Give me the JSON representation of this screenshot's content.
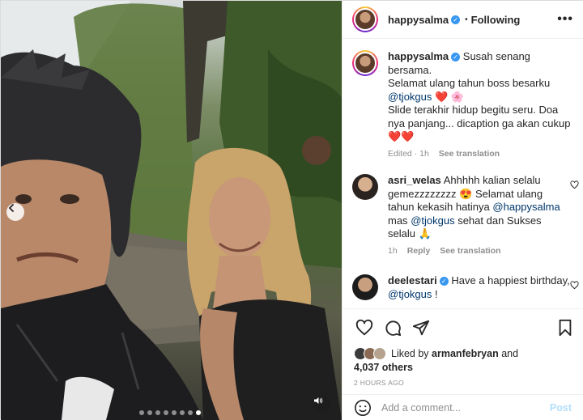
{
  "post": {
    "author": "happysalma",
    "follow_label": "Following",
    "more_label": "•••",
    "dot_separator": "•",
    "caption": {
      "username": "happysalma",
      "text_line1": "Susah senang bersama.",
      "text_line2": "Selamat ulang tahun boss besarku",
      "mention": "@tjokgus",
      "emoji_after_mention": "❤️ 🌸",
      "text_line3": "Slide terakhir hidup begitu seru. Doa nya panjang... dicaption ga akan cukup",
      "emoji_end": "❤️❤️",
      "edited": "Edited · 1h",
      "see_translation": "See translation"
    },
    "comments": [
      {
        "username": "asri_welas",
        "text_a": "Ahhhhh kalian selalu gemezzzzzzzz",
        "emoji_a": "😍",
        "text_b": "Selamat ulang tahun kekasih hatinya",
        "mention_a": "@happysalma",
        "text_c": "mas",
        "mention_b": "@tjokgus",
        "text_d": "sehat dan Sukses selalu",
        "emoji_d": "🙏",
        "time": "1h",
        "reply": "Reply",
        "see_translation": "See translation"
      },
      {
        "username": "deelestari",
        "text_a": "Have a happiest birthday,",
        "mention_a": "@tjokgus",
        "text_b": " !"
      }
    ],
    "liked_by_prefix": "Liked by",
    "liked_by_user": "arman febryan",
    "liked_by_user_display": "armanfebryan",
    "liked_and": "and",
    "likes_count": "4,037 others",
    "time_ago": "2 HOURS AGO",
    "comment_placeholder": "Add a comment...",
    "post_button": "Post"
  },
  "carousel": {
    "slide_count": 8,
    "active_index": 7
  },
  "icons": {
    "prev": "chevron-left-icon",
    "mute": "speaker-icon",
    "like": "heart-icon",
    "comment": "comment-bubble-icon",
    "share": "paper-plane-icon",
    "save": "bookmark-icon",
    "emoji": "smiley-icon"
  },
  "colors": {
    "verified": "#3897f0",
    "mention": "#00376b",
    "heart": "#ed4956",
    "muted_text": "#8e8e8e",
    "post_button": "#b2dffc"
  }
}
